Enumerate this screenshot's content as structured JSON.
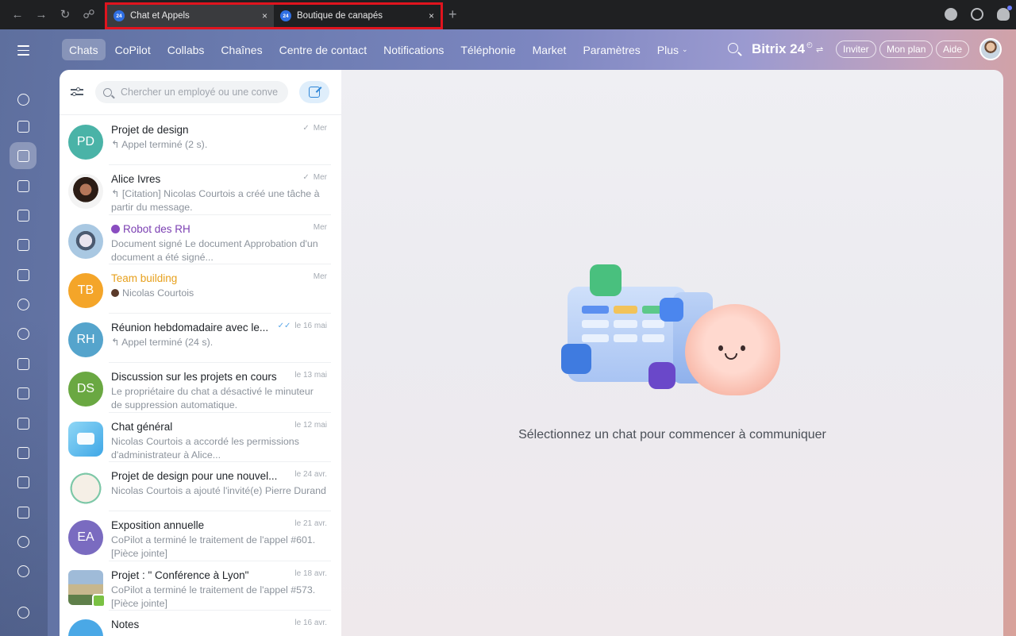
{
  "browser": {
    "tabs": [
      {
        "title": "Chat et Appels",
        "favicon": "24"
      },
      {
        "title": "Boutique de canapés",
        "favicon": "24"
      }
    ],
    "new_tab": "+",
    "close": "×"
  },
  "topnav": {
    "items": [
      "Chats",
      "CoPilot",
      "Collabs",
      "Chaînes",
      "Centre de contact",
      "Notifications",
      "Téléphonie",
      "Market",
      "Paramètres",
      "Plus"
    ],
    "brand": "Bitrix 24",
    "buttons": {
      "invite": "Inviter",
      "plan": "Mon plan",
      "help": "Aide"
    }
  },
  "search": {
    "placeholder": "Chercher un employé ou une conve"
  },
  "chats": [
    {
      "avatar": "PD",
      "color": "#4ab3a7",
      "title": "Projet de design",
      "date": "Mer",
      "check": "✓",
      "snippet": "↰ Appel terminé (2 s)."
    },
    {
      "avatar": "",
      "title": "Alice Ivres",
      "date": "Mer",
      "check": "✓",
      "snippet": "↰ [Citation] Nicolas Courtois a créé une tâche à partir du message."
    },
    {
      "avatar": "",
      "title": "Robot des RH",
      "date": "Mer",
      "snippet": "Document signé Le document Approbation d'un document a été signé..."
    },
    {
      "avatar": "TB",
      "color": "#f4a529",
      "title": "Team building",
      "date": "Mer",
      "snippet": "Nicolas Courtois"
    },
    {
      "avatar": "RH",
      "color": "#55a4cc",
      "title": "Réunion hebdomadaire avec le...",
      "date": "le 16 mai",
      "check": "✓✓",
      "snippet": "↰ Appel terminé (24 s)."
    },
    {
      "avatar": "DS",
      "color": "#6aa842",
      "title": "Discussion sur les projets en cours",
      "date": "le 13 mai",
      "snippet": "Le propriétaire du chat a désactivé le minuteur de suppression automatique."
    },
    {
      "avatar": "",
      "title": "Chat général",
      "date": "le 12 mai",
      "snippet": "Nicolas Courtois a accordé les permissions d'administrateur à Alice..."
    },
    {
      "avatar": "",
      "title": "Projet de design pour une nouvel...",
      "date": "le 24 avr.",
      "snippet": "Nicolas Courtois a ajouté l'invité(e) Pierre Durand"
    },
    {
      "avatar": "EA",
      "color": "#7a6bc0",
      "title": "Exposition annuelle",
      "date": "le 21 avr.",
      "snippet": "CoPilot a terminé le traitement de l'appel #601. [Pièce jointe]"
    },
    {
      "avatar": "",
      "title": "Projet : \" Conférence à Lyon\"",
      "date": "le 18 avr.",
      "snippet": "CoPilot a terminé le traitement de l'appel #573. [Pièce jointe]"
    },
    {
      "avatar": "",
      "title": "Notes",
      "date": "le 16 avr.",
      "snippet": ""
    }
  ],
  "main": {
    "message": "Sélectionnez un chat pour commencer à communiquer"
  },
  "colors": {
    "accent": "#2f86d8",
    "tab_highlight": "#e0141e",
    "robot_title": "#7b3fb2",
    "team_title": "#e7a01c"
  },
  "rail_icons": [
    "menu-icon",
    "flow-icon",
    "feed-icon",
    "chat-icon",
    "calendar-icon",
    "document-icon",
    "drive-icon",
    "mail-icon",
    "contacts-icon",
    "hexagon-icon",
    "workgroups-icon",
    "tasks-icon",
    "crm-icon",
    "box-icon",
    "cart-icon",
    "sites-icon",
    "bot-icon",
    "goal-icon",
    "settings-icon"
  ]
}
